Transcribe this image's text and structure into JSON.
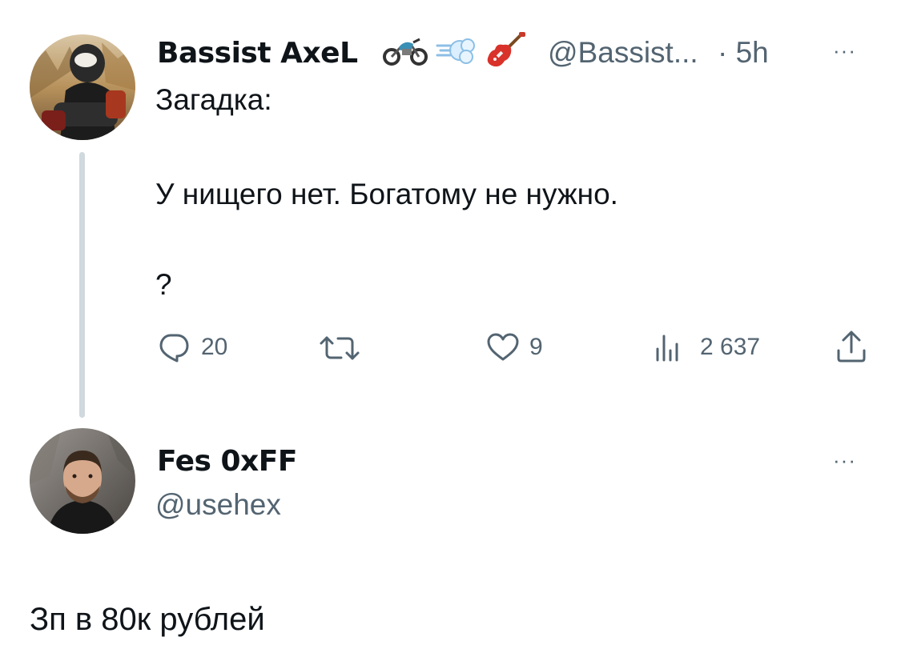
{
  "tweet": {
    "author_name": "Bassist AxeL",
    "author_emojis": [
      "🏍",
      "💨",
      "🎸"
    ],
    "author_handle": "@Bassist...",
    "time": "· 5h",
    "more_label": "···",
    "text_line1": "Загадка:",
    "text_line2": "У нищего нет. Богатому не нужно.",
    "text_line3": "?",
    "reply_count": "20",
    "retweet_count": "",
    "like_count": "9",
    "view_count": "2 637"
  },
  "reply": {
    "author_name": "Fes 0xFF",
    "author_handle": "@usehex",
    "more_label": "···",
    "text": "Зп в 80к рублей"
  },
  "colors": {
    "text_primary": "#0f1419",
    "text_secondary": "#536471",
    "thread_line": "#cfd9de"
  }
}
